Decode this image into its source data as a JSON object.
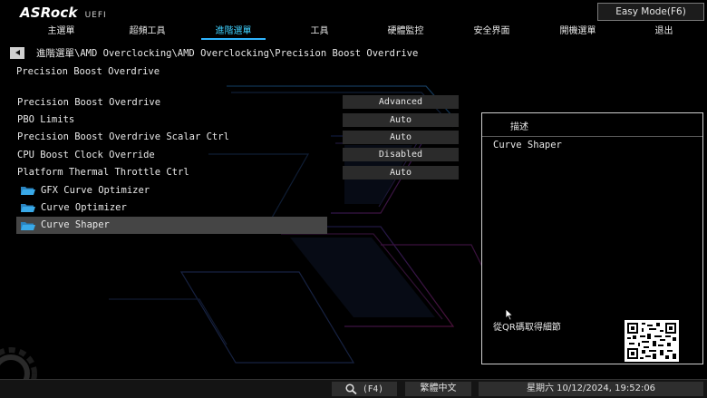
{
  "header": {
    "brand": "ASRock",
    "uefi": "UEFI",
    "easy_mode_label": "Easy Mode(F6)"
  },
  "menu": {
    "items": [
      {
        "label": "主選單"
      },
      {
        "label": "超頻工具"
      },
      {
        "label": "進階選單"
      },
      {
        "label": "工具"
      },
      {
        "label": "硬體監控"
      },
      {
        "label": "安全界面"
      },
      {
        "label": "開機選單"
      },
      {
        "label": "退出"
      }
    ],
    "active_index": 2
  },
  "breadcrumb": "進階選單\\AMD Overclocking\\AMD Overclocking\\Precision Boost Overdrive",
  "page_title": "Precision Boost Overdrive",
  "settings": [
    {
      "label": "Precision Boost Overdrive",
      "value": "Advanced"
    },
    {
      "label": "PBO Limits",
      "value": "Auto"
    },
    {
      "label": "Precision Boost Overdrive Scalar Ctrl",
      "value": "Auto"
    },
    {
      "label": "CPU Boost Clock Override",
      "value": "Disabled"
    },
    {
      "label": "Platform Thermal Throttle Ctrl",
      "value": "Auto"
    }
  ],
  "folders": [
    {
      "label": "GFX Curve Optimizer"
    },
    {
      "label": "Curve Optimizer"
    },
    {
      "label": "Curve Shaper"
    }
  ],
  "selected_folder": "Curve Shaper",
  "description": {
    "header": "描述",
    "text": "Curve Shaper",
    "qr_label": "從QR碼取得細節"
  },
  "footer": {
    "search_key": "(F4)",
    "language": "繁體中文",
    "clock": "星期六 10/12/2024, 19:52:06"
  },
  "colors": {
    "accent": "#2fb5ff",
    "value_bg": "#2b2b2b",
    "highlight_bg": "#454545",
    "folder_icon": "#39a9e8"
  },
  "icons": {
    "back": "back-arrow-icon",
    "folder": "folder-icon",
    "search": "search-icon",
    "cursor": "mouse-cursor-icon"
  }
}
